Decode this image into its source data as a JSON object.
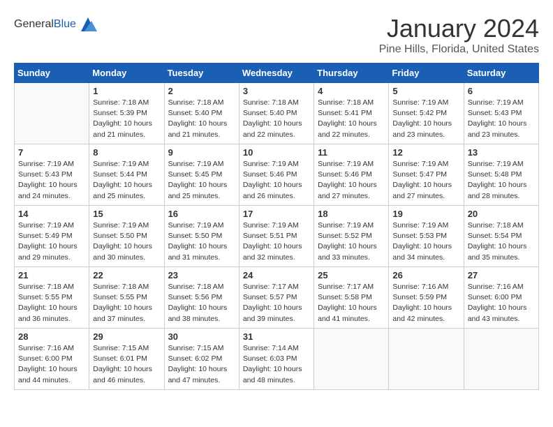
{
  "header": {
    "logo_general": "General",
    "logo_blue": "Blue",
    "month_title": "January 2024",
    "location": "Pine Hills, Florida, United States"
  },
  "days_of_week": [
    "Sunday",
    "Monday",
    "Tuesday",
    "Wednesday",
    "Thursday",
    "Friday",
    "Saturday"
  ],
  "weeks": [
    [
      {
        "num": "",
        "empty": true
      },
      {
        "num": "1",
        "sunrise": "7:18 AM",
        "sunset": "5:39 PM",
        "daylight": "10 hours and 21 minutes."
      },
      {
        "num": "2",
        "sunrise": "7:18 AM",
        "sunset": "5:40 PM",
        "daylight": "10 hours and 21 minutes."
      },
      {
        "num": "3",
        "sunrise": "7:18 AM",
        "sunset": "5:40 PM",
        "daylight": "10 hours and 22 minutes."
      },
      {
        "num": "4",
        "sunrise": "7:18 AM",
        "sunset": "5:41 PM",
        "daylight": "10 hours and 22 minutes."
      },
      {
        "num": "5",
        "sunrise": "7:19 AM",
        "sunset": "5:42 PM",
        "daylight": "10 hours and 23 minutes."
      },
      {
        "num": "6",
        "sunrise": "7:19 AM",
        "sunset": "5:43 PM",
        "daylight": "10 hours and 23 minutes."
      }
    ],
    [
      {
        "num": "7",
        "sunrise": "7:19 AM",
        "sunset": "5:43 PM",
        "daylight": "10 hours and 24 minutes."
      },
      {
        "num": "8",
        "sunrise": "7:19 AM",
        "sunset": "5:44 PM",
        "daylight": "10 hours and 25 minutes."
      },
      {
        "num": "9",
        "sunrise": "7:19 AM",
        "sunset": "5:45 PM",
        "daylight": "10 hours and 25 minutes."
      },
      {
        "num": "10",
        "sunrise": "7:19 AM",
        "sunset": "5:46 PM",
        "daylight": "10 hours and 26 minutes."
      },
      {
        "num": "11",
        "sunrise": "7:19 AM",
        "sunset": "5:46 PM",
        "daylight": "10 hours and 27 minutes."
      },
      {
        "num": "12",
        "sunrise": "7:19 AM",
        "sunset": "5:47 PM",
        "daylight": "10 hours and 27 minutes."
      },
      {
        "num": "13",
        "sunrise": "7:19 AM",
        "sunset": "5:48 PM",
        "daylight": "10 hours and 28 minutes."
      }
    ],
    [
      {
        "num": "14",
        "sunrise": "7:19 AM",
        "sunset": "5:49 PM",
        "daylight": "10 hours and 29 minutes."
      },
      {
        "num": "15",
        "sunrise": "7:19 AM",
        "sunset": "5:50 PM",
        "daylight": "10 hours and 30 minutes."
      },
      {
        "num": "16",
        "sunrise": "7:19 AM",
        "sunset": "5:50 PM",
        "daylight": "10 hours and 31 minutes."
      },
      {
        "num": "17",
        "sunrise": "7:19 AM",
        "sunset": "5:51 PM",
        "daylight": "10 hours and 32 minutes."
      },
      {
        "num": "18",
        "sunrise": "7:19 AM",
        "sunset": "5:52 PM",
        "daylight": "10 hours and 33 minutes."
      },
      {
        "num": "19",
        "sunrise": "7:19 AM",
        "sunset": "5:53 PM",
        "daylight": "10 hours and 34 minutes."
      },
      {
        "num": "20",
        "sunrise": "7:18 AM",
        "sunset": "5:54 PM",
        "daylight": "10 hours and 35 minutes."
      }
    ],
    [
      {
        "num": "21",
        "sunrise": "7:18 AM",
        "sunset": "5:55 PM",
        "daylight": "10 hours and 36 minutes."
      },
      {
        "num": "22",
        "sunrise": "7:18 AM",
        "sunset": "5:55 PM",
        "daylight": "10 hours and 37 minutes."
      },
      {
        "num": "23",
        "sunrise": "7:18 AM",
        "sunset": "5:56 PM",
        "daylight": "10 hours and 38 minutes."
      },
      {
        "num": "24",
        "sunrise": "7:17 AM",
        "sunset": "5:57 PM",
        "daylight": "10 hours and 39 minutes."
      },
      {
        "num": "25",
        "sunrise": "7:17 AM",
        "sunset": "5:58 PM",
        "daylight": "10 hours and 41 minutes."
      },
      {
        "num": "26",
        "sunrise": "7:16 AM",
        "sunset": "5:59 PM",
        "daylight": "10 hours and 42 minutes."
      },
      {
        "num": "27",
        "sunrise": "7:16 AM",
        "sunset": "6:00 PM",
        "daylight": "10 hours and 43 minutes."
      }
    ],
    [
      {
        "num": "28",
        "sunrise": "7:16 AM",
        "sunset": "6:00 PM",
        "daylight": "10 hours and 44 minutes."
      },
      {
        "num": "29",
        "sunrise": "7:15 AM",
        "sunset": "6:01 PM",
        "daylight": "10 hours and 46 minutes."
      },
      {
        "num": "30",
        "sunrise": "7:15 AM",
        "sunset": "6:02 PM",
        "daylight": "10 hours and 47 minutes."
      },
      {
        "num": "31",
        "sunrise": "7:14 AM",
        "sunset": "6:03 PM",
        "daylight": "10 hours and 48 minutes."
      },
      {
        "num": "",
        "empty": true
      },
      {
        "num": "",
        "empty": true
      },
      {
        "num": "",
        "empty": true
      }
    ]
  ]
}
